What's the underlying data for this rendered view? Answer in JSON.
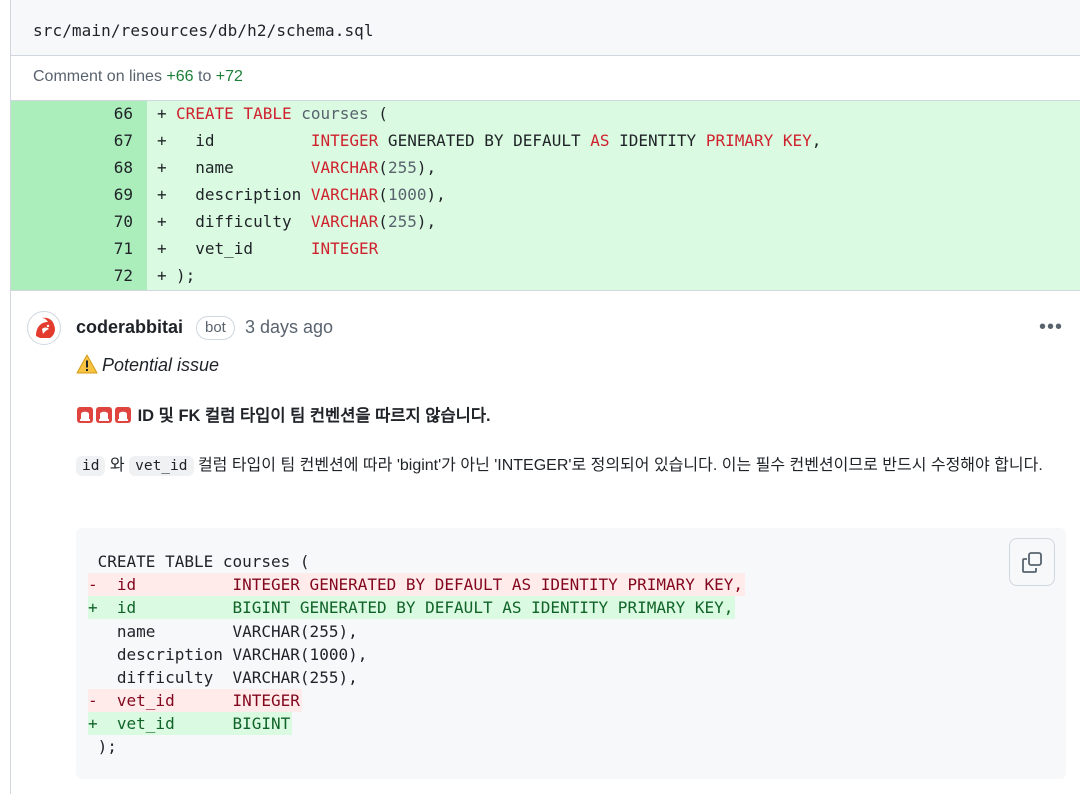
{
  "file": {
    "path": "src/main/resources/db/h2/schema.sql"
  },
  "comment_on": {
    "prefix": "Comment on lines",
    "start": "+66",
    "to": "to",
    "end": "+72"
  },
  "diff_lines": [
    {
      "num": "66",
      "sign": "+",
      "text": "CREATE TABLE courses ("
    },
    {
      "num": "67",
      "sign": "+",
      "text": "  id          INTEGER GENERATED BY DEFAULT AS IDENTITY PRIMARY KEY,"
    },
    {
      "num": "68",
      "sign": "+",
      "text": "  name        VARCHAR(255),"
    },
    {
      "num": "69",
      "sign": "+",
      "text": "  description VARCHAR(1000),"
    },
    {
      "num": "70",
      "sign": "+",
      "text": "  difficulty  VARCHAR(255),"
    },
    {
      "num": "71",
      "sign": "+",
      "text": "  vet_id      INTEGER"
    },
    {
      "num": "72",
      "sign": "+",
      "text": ");"
    }
  ],
  "comment": {
    "author": "coderabbitai",
    "badge": "bot",
    "time": "3 days ago",
    "menu": "•••",
    "severity_text": "Potential issue",
    "title": "ID 및 FK 컬럼 타입이 팀 컨벤션을 따르지 않습니다.",
    "body": {
      "code1": "id",
      "conj": "와",
      "code2": "vet_id",
      "rest": "컬럼 타입이 팀 컨벤션에 따라 'bigint'가 아닌 'INTEGER'로 정의되어 있습니다. 이는 필수 컨벤션이므로 반드시 수정해야 합니다."
    },
    "suggestion": [
      {
        "type": "ctx",
        "text": " CREATE TABLE courses ("
      },
      {
        "type": "del",
        "text": "-  id          INTEGER GENERATED BY DEFAULT AS IDENTITY PRIMARY KEY,"
      },
      {
        "type": "add",
        "text": "+  id          BIGINT GENERATED BY DEFAULT AS IDENTITY PRIMARY KEY,"
      },
      {
        "type": "ctx",
        "text": "   name        VARCHAR(255),"
      },
      {
        "type": "ctx",
        "text": "   description VARCHAR(1000),"
      },
      {
        "type": "ctx",
        "text": "   difficulty  VARCHAR(255),"
      },
      {
        "type": "del",
        "text": "-  vet_id      INTEGER"
      },
      {
        "type": "add",
        "text": "+  vet_id      BIGINT"
      },
      {
        "type": "ctx",
        "text": " );"
      }
    ]
  },
  "colors": {
    "added_bg": "#dafbe1",
    "added_gutter": "#aceebb",
    "keyword": "#cf222e",
    "deleted_bg": "#ffebe9"
  },
  "icons": {
    "avatar": "coderabbit-avatar",
    "warning": "warning-icon",
    "siren": "siren-icon",
    "copy": "copy-icon",
    "more": "kebab-menu-icon"
  }
}
